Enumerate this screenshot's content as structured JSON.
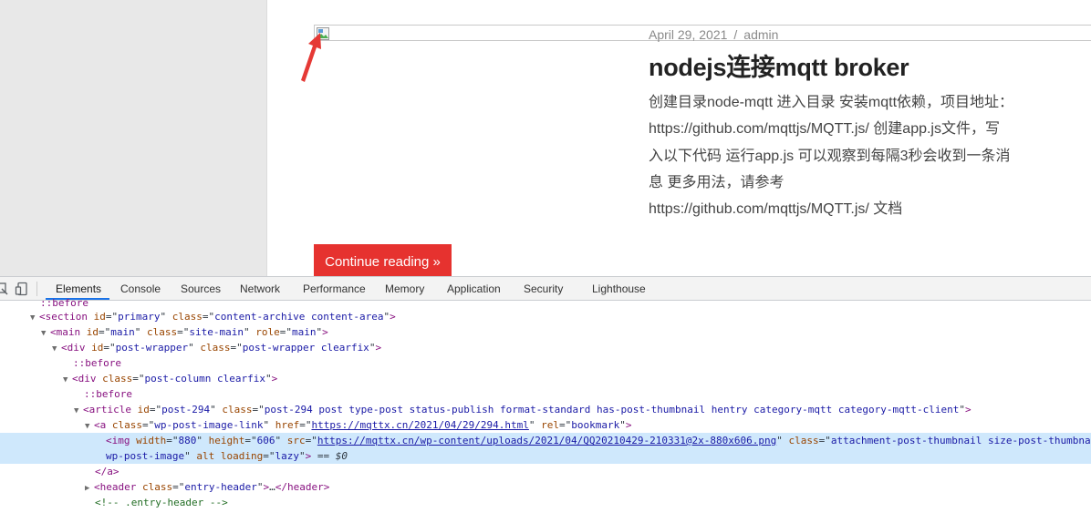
{
  "post": {
    "date": "April 29, 2021",
    "separator": "/",
    "author": "admin",
    "title": "nodejs连接mqtt broker",
    "excerpt_lines": [
      "创建目录node-mqtt 进入目录 安装mqtt依赖，项目地址：",
      "https://github.com/mqttjs/MQTT.js/ 创建app.js文件，写",
      "入以下代码 运行app.js 可以观察到每隔3秒会收到一条消",
      "息 更多用法，请参考",
      "https://github.com/mqttjs/MQTT.js/ 文档"
    ],
    "continue_label": "Continue reading »"
  },
  "devtools": {
    "tabs": [
      "Elements",
      "Console",
      "Sources",
      "Network",
      "Performance",
      "Memory",
      "Application",
      "Security",
      "Lighthouse"
    ],
    "active_tab": "Elements",
    "dom": {
      "r0": "::before",
      "r1": {
        "tag": "section",
        "attrs": [
          [
            "id",
            "primary"
          ],
          [
            "class",
            "content-archive content-area"
          ]
        ]
      },
      "r2": {
        "tag": "main",
        "attrs": [
          [
            "id",
            "main"
          ],
          [
            "class",
            "site-main"
          ],
          [
            "role",
            "main"
          ]
        ]
      },
      "r3": {
        "tag": "div",
        "attrs": [
          [
            "id",
            "post-wrapper"
          ],
          [
            "class",
            "post-wrapper clearfix"
          ]
        ]
      },
      "r4": "::before",
      "r5": {
        "tag": "div",
        "attrs": [
          [
            "class",
            "post-column clearfix"
          ]
        ]
      },
      "r6": "::before",
      "r7": {
        "tag": "article",
        "attrs": [
          [
            "id",
            "post-294"
          ],
          [
            "class",
            "post-294 post type-post status-publish format-standard has-post-thumbnail hentry category-mqtt category-mqtt-client"
          ]
        ]
      },
      "r8": {
        "tag": "a",
        "class_val": "wp-post-image-link",
        "href": "https://mqttx.cn/2021/04/29/294.html",
        "rel": "bookmark"
      },
      "r9": {
        "tag": "img",
        "width": "880",
        "height": "606",
        "src": "https://mqttx.cn/wp-content/uploads/2021/04/QQ20210429-210331@2x-880x606.png",
        "class_val": "attachment-post-thumbnail size-post-thumbnai"
      },
      "r10": {
        "class_cont": "wp-post-image",
        "alt": "alt",
        "loading": "lazy",
        "eq": "== $0"
      },
      "r11": "</a>",
      "r12": {
        "tag": "header",
        "class_val": "entry-header",
        "ellipsis": "…"
      },
      "r13": "<!-- .entry-header -->"
    }
  }
}
